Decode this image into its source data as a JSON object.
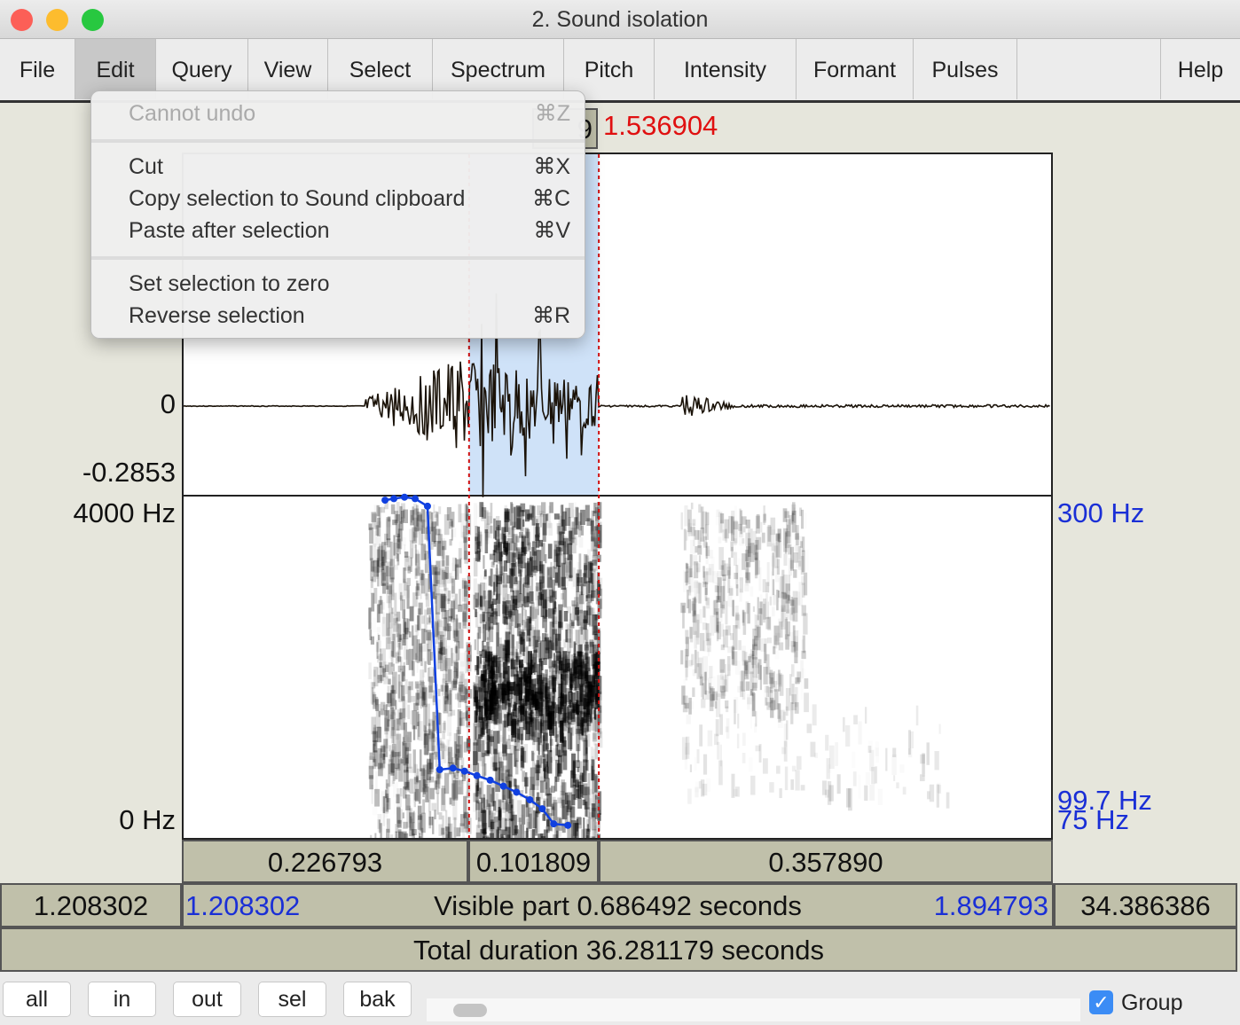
{
  "window": {
    "title": "2. Sound isolation"
  },
  "menubar": [
    "File",
    "Edit",
    "Query",
    "View",
    "Select",
    "Spectrum",
    "Pitch",
    "Intensity",
    "Formant",
    "Pulses",
    "Help"
  ],
  "edit_menu": {
    "items": [
      {
        "label": "Cannot undo",
        "shortcut": "⌘Z",
        "disabled": true
      },
      {
        "label": "Cut",
        "shortcut": "⌘X"
      },
      {
        "label": "Copy selection to Sound clipboard",
        "shortcut": "⌘C"
      },
      {
        "label": "Paste after selection",
        "shortcut": "⌘V"
      },
      {
        "label": "Set selection to zero",
        "shortcut": ""
      },
      {
        "label": "Reverse selection",
        "shortcut": "⌘R"
      }
    ]
  },
  "cursor": {
    "partial_left": "9",
    "end": "1.536904"
  },
  "waveform": {
    "zero_label": "0",
    "min_label": "-0.2853"
  },
  "spectrogram": {
    "top_label": "4000 Hz",
    "bottom_label": "0 Hz"
  },
  "pitch": {
    "top_label": "300 Hz",
    "cursor_label": "99.7 Hz",
    "bottom_label": "75 Hz",
    "color": "#1040e0",
    "points": [
      [
        1.3677,
        297
      ],
      [
        1.3747,
        298
      ],
      [
        1.3831,
        299
      ],
      [
        1.3915,
        298
      ],
      [
        1.4013,
        293
      ],
      [
        1.411,
        118
      ],
      [
        1.4215,
        119
      ],
      [
        1.4306,
        117
      ],
      [
        1.4404,
        114
      ],
      [
        1.4509,
        111
      ],
      [
        1.4614,
        107
      ],
      [
        1.4718,
        103
      ],
      [
        1.4823,
        98
      ],
      [
        1.4921,
        92
      ],
      [
        1.5012,
        82
      ],
      [
        1.5124,
        81
      ]
    ]
  },
  "selection": {
    "start": 1.4342,
    "end": 1.536904,
    "color": "#cfe2f8"
  },
  "durations": {
    "before": "0.226793",
    "selection": "0.101809",
    "after": "0.357890"
  },
  "visible": {
    "left_hidden": "1.208302",
    "start": "1.208302",
    "label": "Visible part 0.686492 seconds",
    "end": "1.894793",
    "right_hidden": "34.386386"
  },
  "total": "Total duration 36.281179 seconds",
  "buttons": [
    "all",
    "in",
    "out",
    "sel",
    "bak"
  ],
  "group": {
    "label": "Group",
    "checked": true
  }
}
